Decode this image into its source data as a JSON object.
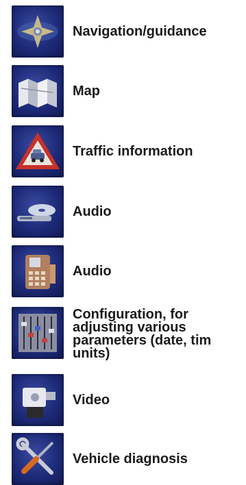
{
  "menu": {
    "items": [
      {
        "label": "Navigation/guidance",
        "icon": "navigation-compass-icon"
      },
      {
        "label": "Map",
        "icon": "folded-map-icon"
      },
      {
        "label": "Traffic information",
        "icon": "traffic-warning-triangle-icon"
      },
      {
        "label": "Audio",
        "icon": "cd-player-icon"
      },
      {
        "label": "Audio",
        "icon": "phone-keypad-icon"
      },
      {
        "label": "Configuration, for\nadjusting various\nparameters (date, tim\nunits)",
        "icon": "settings-sliders-icon"
      },
      {
        "label": "Video",
        "icon": "video-camera-icon"
      },
      {
        "label": "Vehicle diagnosis",
        "icon": "wrench-screwdriver-icon"
      }
    ]
  }
}
